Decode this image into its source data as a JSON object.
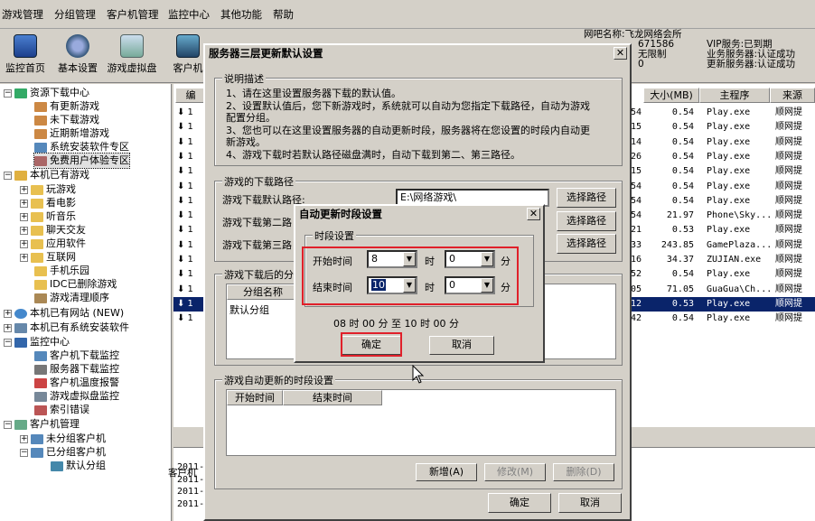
{
  "menu": [
    "游戏管理",
    "分组管理",
    "客户机管理",
    "监控中心",
    "其他功能",
    "帮助"
  ],
  "toolbar": [
    {
      "label": "监控首页",
      "icon": "monitor-icon"
    },
    {
      "label": "基本设置",
      "icon": "settings-icon"
    },
    {
      "label": "游戏虚拟盘",
      "icon": "virtual-disk-icon"
    },
    {
      "label": "客户机",
      "icon": "client-icon"
    }
  ],
  "info": {
    "name_line": "网吧名称:飞龙网络会所",
    "id_line": "671586",
    "limit_line": "无限制",
    "zero_line": "0",
    "vip": "VIP服务:已到期",
    "business": "业务服务器:认证成功",
    "update": "更新服务器:认证成功"
  },
  "tree": {
    "root1": "资源下载中心",
    "items1": [
      "有更新游戏",
      "未下载游戏",
      "近期新增游戏",
      "系统安装软件专区",
      "免费用户体验专区"
    ],
    "root2": "本机已有游戏",
    "items2": [
      "玩游戏",
      "看电影",
      "听音乐",
      "聊天交友",
      "应用软件",
      "互联网",
      "手机乐园",
      "IDC已删除游戏",
      "游戏清理顺序"
    ],
    "root3": "本机已有网站 (NEW)",
    "root4": "本机已有系统安装软件",
    "root5": "监控中心",
    "items5": [
      "客户机下载监控",
      "服务器下载监控",
      "客户机温度报警",
      "游戏虚拟盘监控",
      "索引错误"
    ],
    "root6": "客户机管理",
    "items6": [
      "未分组客户机",
      "已分组客户机"
    ],
    "leaf6": "默认分组"
  },
  "grid": {
    "headers": [
      "编",
      "大小(MB)",
      "主程序",
      "来源"
    ],
    "rows": [
      {
        "a": "1",
        "n": "54",
        "size": "0.54",
        "exe": "Play.exe",
        "src": "顺网提"
      },
      {
        "a": "1",
        "n": "15",
        "size": "0.54",
        "exe": "Play.exe",
        "src": "顺网提"
      },
      {
        "a": "1",
        "n": "14",
        "size": "0.54",
        "exe": "Play.exe",
        "src": "顺网提"
      },
      {
        "a": "1",
        "n": "26",
        "size": "0.54",
        "exe": "Play.exe",
        "src": "顺网提"
      },
      {
        "a": "1",
        "n": "15",
        "size": "0.54",
        "exe": "Play.exe",
        "src": "顺网提"
      },
      {
        "a": "1",
        "n": "54",
        "size": "0.54",
        "exe": "Play.exe",
        "src": "顺网提"
      },
      {
        "a": "1",
        "n": "54",
        "size": "0.54",
        "exe": "Play.exe",
        "src": "顺网提"
      },
      {
        "a": "1",
        "n": "54",
        "size": "21.97",
        "exe": "Phone\\Sky...",
        "src": "顺网提"
      },
      {
        "a": "1",
        "n": "21",
        "size": "0.53",
        "exe": "Play.exe",
        "src": "顺网提"
      },
      {
        "a": "1",
        "n": "33",
        "size": "243.85",
        "exe": "GamePlaza...",
        "src": "顺网提"
      },
      {
        "a": "1",
        "n": "16",
        "size": "34.37",
        "exe": "ZUJIAN.exe",
        "src": "顺网提"
      },
      {
        "a": "1",
        "n": "52",
        "size": "0.54",
        "exe": "Play.exe",
        "src": "顺网提"
      },
      {
        "a": "1",
        "n": "05",
        "size": "71.05",
        "exe": "GuaGua\\Ch...",
        "src": "顺网提"
      },
      {
        "a": "1",
        "n": "12",
        "size": "0.53",
        "exe": "Play.exe",
        "src": "顺网提"
      },
      {
        "a": "1",
        "n": "42",
        "size": "0.54",
        "exe": "Play.exe",
        "src": "顺网提"
      }
    ],
    "selected_index": 13
  },
  "bottom": {
    "tab": "客户机",
    "lines": [
      "2011-",
      "2011-",
      "2011-",
      "2011-"
    ]
  },
  "main_dialog": {
    "title": "服务器三层更新默认设置",
    "desc_label": "说明描述",
    "desc": [
      "1、请在这里设置服务器下载的默认值。",
      "2、设置默认值后，您下新游戏时，系统就可以自动为您指定下载路径，自动为游戏",
      "配置分组。",
      "3、您也可以在这里设置服务器的自动更新时段，服务器将在您设置的时段内自动更",
      "新游戏。",
      "4、游戏下载时若默认路径磁盘满时，自动下载到第二、第三路径。"
    ],
    "path_group": "游戏的下载路径",
    "path1_label": "游戏下载默认路径:",
    "path1_value": "E:\\网络游戏\\",
    "path2_label": "游戏下载第二路",
    "path3_label": "游戏下载第三路",
    "choose_path": "选择路径",
    "group_group": "游戏下载后的分",
    "group_col": "分组名称",
    "group_row": "默认分组",
    "auto_group": "游戏自动更新的时段设置",
    "col_start": "开始时间",
    "col_end": "结束时间",
    "add": "新增(A)",
    "modify": "修改(M)",
    "delete": "删除(D)",
    "ok": "确定",
    "cancel": "取消"
  },
  "time_dialog": {
    "title": "自动更新时段设置",
    "group": "时段设置",
    "start_label": "开始时间",
    "start_hour": "8",
    "start_min": "0",
    "end_label": "结束时间",
    "end_hour": "10",
    "end_min": "0",
    "hour_unit": "时",
    "min_unit": "分",
    "summary": "08 时 00 分 至 10 时 00 分",
    "ok": "确定",
    "cancel": "取消"
  }
}
